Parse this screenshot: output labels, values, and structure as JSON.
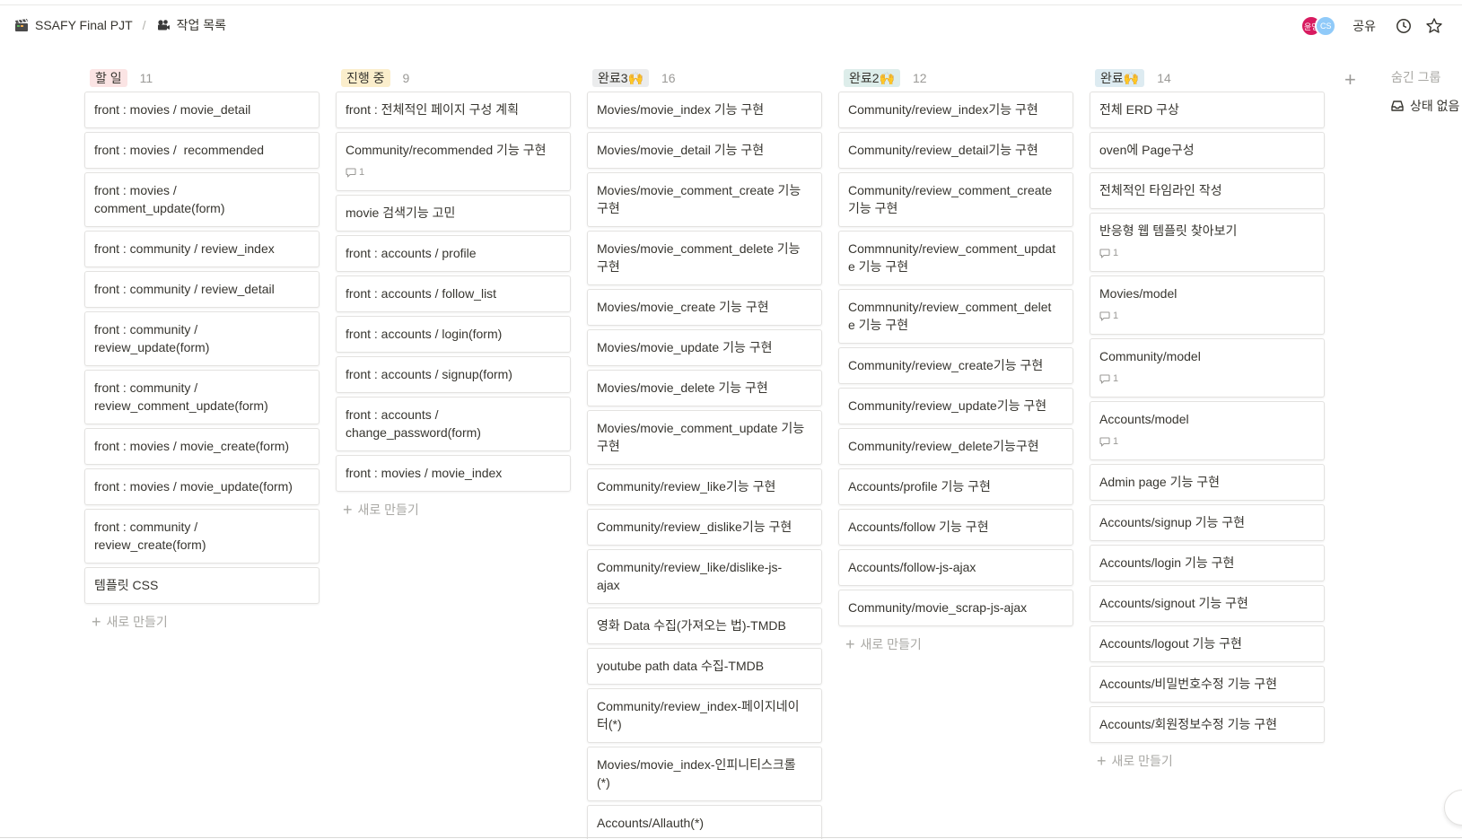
{
  "breadcrumb": {
    "workspace": "SSAFY Final PJT",
    "page": "작업 목록"
  },
  "topbar": {
    "avatars": [
      "윤영",
      "CS"
    ],
    "share_label": "공유",
    "history_icon": "clock-icon",
    "favorite_icon": "star-icon"
  },
  "columns": [
    {
      "label": "할 일",
      "count": "11",
      "color": "#fbe4e4",
      "cards": [
        {
          "title": "front : movies / movie_detail"
        },
        {
          "title": "front : movies /  recommended"
        },
        {
          "title": "front : movies /\ncomment_update(form)"
        },
        {
          "title": "front : community / review_index"
        },
        {
          "title": "front : community / review_detail"
        },
        {
          "title": "front : community /\nreview_update(form)"
        },
        {
          "title": "front : community /\nreview_comment_update(form)"
        },
        {
          "title": "front : movies / movie_create(form)"
        },
        {
          "title": "front : movies / movie_update(form)"
        },
        {
          "title": "front : community /\nreview_create(form)"
        },
        {
          "title": "템플릿 CSS"
        }
      ],
      "new_label": "새로 만들기"
    },
    {
      "label": "진행 중",
      "count": "9",
      "color": "#fbeecc",
      "cards": [
        {
          "title": "front : 전체적인 페이지 구성 계획"
        },
        {
          "title": "Community/recommended 기능 구현",
          "comments": "1"
        },
        {
          "title": "movie 검색기능 고민"
        },
        {
          "title": "front : accounts / profile"
        },
        {
          "title": "front : accounts / follow_list"
        },
        {
          "title": "front : accounts / login(form)"
        },
        {
          "title": "front : accounts / signup(form)"
        },
        {
          "title": "front : accounts /\nchange_password(form)"
        },
        {
          "title": "front : movies / movie_index"
        }
      ],
      "new_label": "새로 만들기"
    },
    {
      "label": "완료3🙌",
      "count": "16",
      "color": "#ebeced",
      "cards": [
        {
          "title": "Movies/movie_index 기능 구현"
        },
        {
          "title": "Movies/movie_detail 기능 구현"
        },
        {
          "title": "Movies/movie_comment_create 기능\n구현"
        },
        {
          "title": "Movies/movie_comment_delete 기능\n구현"
        },
        {
          "title": "Movies/movie_create 기능 구현"
        },
        {
          "title": "Movies/movie_update 기능 구현"
        },
        {
          "title": "Movies/movie_delete 기능 구현"
        },
        {
          "title": "Movies/movie_comment_update 기능\n구현"
        },
        {
          "title": "Community/review_like기능 구현"
        },
        {
          "title": "Community/review_dislike기능 구현"
        },
        {
          "title": "Community/review_like/dislike-js-\najax"
        },
        {
          "title": "영화 Data 수집(가져오는 법)-TMDB"
        },
        {
          "title": "youtube path data 수집-TMDB"
        },
        {
          "title": "Community/review_index-페이지네이\n터(*)"
        },
        {
          "title": "Movies/movie_index-인피니티스크롤\n(*)"
        },
        {
          "title": "Accounts/Allauth(*)"
        }
      ]
    },
    {
      "label": "완료2🙌",
      "count": "12",
      "color": "#ddedea",
      "cards": [
        {
          "title": "Community/review_index기능 구현"
        },
        {
          "title": "Community/review_detail기능 구현"
        },
        {
          "title": "Community/review_comment_create\n기능 구현"
        },
        {
          "title": "Commnunity/review_comment_updat\ne 기능 구현"
        },
        {
          "title": "Commnunity/review_comment_delet\ne 기능 구현"
        },
        {
          "title": "Community/review_create기능 구현"
        },
        {
          "title": "Community/review_update기능 구현"
        },
        {
          "title": "Community/review_delete기능구현"
        },
        {
          "title": "Accounts/profile 기능 구현"
        },
        {
          "title": "Accounts/follow 기능 구현"
        },
        {
          "title": "Accounts/follow-js-ajax"
        },
        {
          "title": "Community/movie_scrap-js-ajax"
        }
      ],
      "new_label": "새로 만들기"
    },
    {
      "label": "완료🙌",
      "count": "14",
      "color": "#ddebf1",
      "cards": [
        {
          "title": "전체 ERD 구상"
        },
        {
          "title": "oven에 Page구성"
        },
        {
          "title": "전체적인 타임라인 작성"
        },
        {
          "title": "반응형 웹 템플릿 찾아보기",
          "comments": "1"
        },
        {
          "title": "Movies/model",
          "comments": "1"
        },
        {
          "title": "Community/model",
          "comments": "1"
        },
        {
          "title": "Accounts/model",
          "comments": "1"
        },
        {
          "title": "Admin page 기능 구현"
        },
        {
          "title": "Accounts/signup 기능 구현"
        },
        {
          "title": "Accounts/login 기능 구현"
        },
        {
          "title": "Accounts/signout 기능 구현"
        },
        {
          "title": "Accounts/logout 기능 구현"
        },
        {
          "title": "Accounts/비밀번호수정 기능 구현"
        },
        {
          "title": "Accounts/회원정보수정 기능 구현"
        }
      ],
      "new_label": "새로 만들기"
    }
  ],
  "hidden_groups": {
    "title": "숨긴 그룹",
    "items": [
      {
        "label": "상태 없음",
        "icon": "inbox-icon"
      }
    ]
  }
}
